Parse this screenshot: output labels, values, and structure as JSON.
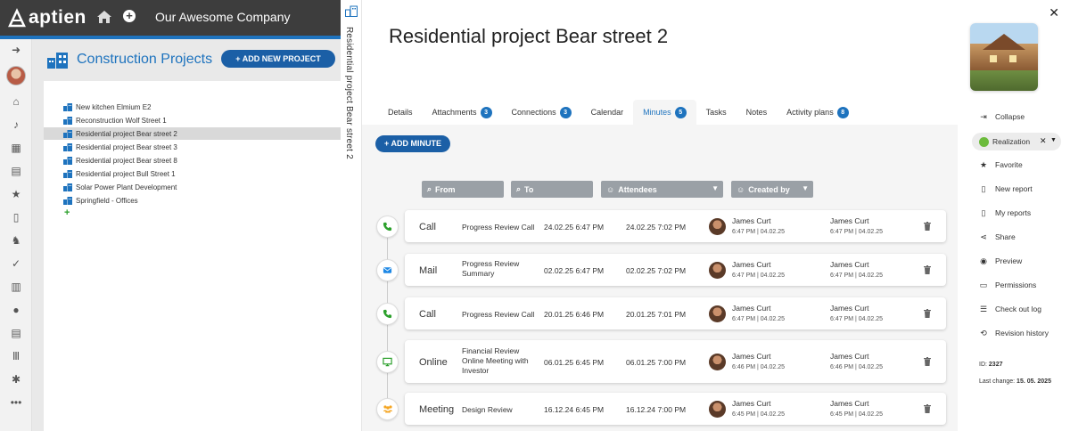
{
  "app": {
    "logo": "aptien",
    "company": "Our Awesome Company"
  },
  "projects": {
    "title": "Construction Projects",
    "add_button": "+ ADD NEW PROJECT",
    "items": [
      "New kitchen Elmium E2",
      "Reconstruction Wolf Street 1",
      "Residential project Bear street 2",
      "Residential project Bear street 3",
      "Residential project Bear street 8",
      "Residential project Bull Street 1",
      "Solar Power Plant Development",
      "Springfield - Offices"
    ],
    "selected_index": 2,
    "add_item": "+"
  },
  "vertical_title": "Residential project Bear street 2",
  "detail": {
    "title": "Residential project Bear street 2",
    "tabs": [
      {
        "label": "Details",
        "badge": ""
      },
      {
        "label": "Attachments",
        "badge": "3"
      },
      {
        "label": "Connections",
        "badge": "3"
      },
      {
        "label": "Calendar",
        "badge": ""
      },
      {
        "label": "Minutes",
        "badge": "5"
      },
      {
        "label": "Tasks",
        "badge": ""
      },
      {
        "label": "Notes",
        "badge": ""
      },
      {
        "label": "Activity plans",
        "badge": "8"
      }
    ],
    "active_tab": "Minutes",
    "add_minute": "+ ADD MINUTE",
    "filters": {
      "from": "From",
      "to": "To",
      "attendees": "Attendees",
      "created_by": "Created by"
    },
    "minutes": [
      {
        "type": "Call",
        "icon": "phone-icon",
        "subject": "Progress Review Call",
        "from": "24.02.25 6:47 PM",
        "to": "24.02.25 7:02 PM",
        "attendee": "James Curt",
        "attendee_time": "6:47 PM | 04.02.25",
        "creator": "James Curt",
        "creator_time": "6:47 PM | 04.02.25"
      },
      {
        "type": "Mail",
        "icon": "mail-icon",
        "subject": "Progress Review Summary",
        "from": "02.02.25 6:47 PM",
        "to": "02.02.25 7:02 PM",
        "attendee": "James Curt",
        "attendee_time": "6:47 PM | 04.02.25",
        "creator": "James Curt",
        "creator_time": "6:47 PM | 04.02.25"
      },
      {
        "type": "Call",
        "icon": "phone-icon",
        "subject": "Progress Review Call",
        "from": "20.01.25 6:46 PM",
        "to": "20.01.25 7:01 PM",
        "attendee": "James Curt",
        "attendee_time": "6:47 PM | 04.02.25",
        "creator": "James Curt",
        "creator_time": "6:47 PM | 04.02.25"
      },
      {
        "type": "Online",
        "icon": "monitor-icon",
        "subject": "Financial Review Online Meeting with Investor",
        "from": "06.01.25 6:45 PM",
        "to": "06.01.25 7:00 PM",
        "attendee": "James Curt",
        "attendee_time": "6:46 PM | 04.02.25",
        "creator": "James Curt",
        "creator_time": "6:46 PM | 04.02.25"
      },
      {
        "type": "Meeting",
        "icon": "people-icon",
        "subject": "Design Review",
        "from": "16.12.24 6:45 PM",
        "to": "16.12.24 7:00 PM",
        "attendee": "James Curt",
        "attendee_time": "6:45 PM | 04.02.25",
        "creator": "James Curt",
        "creator_time": "6:45 PM | 04.02.25"
      }
    ]
  },
  "sidebar": {
    "collapse": "Collapse",
    "status": "Realization",
    "status_color": "#6cbb3c",
    "actions": [
      "Favorite",
      "New report",
      "My reports",
      "Share",
      "Preview",
      "Permissions",
      "Check out log",
      "Revision history"
    ],
    "id_label": "ID:",
    "id_value": "2327",
    "last_change_label": "Last change:",
    "last_change_value": "15. 05. 2025"
  },
  "colors": {
    "accent": "#1e73be",
    "button": "#1b5fa6",
    "topbar": "#3d3d3d"
  }
}
